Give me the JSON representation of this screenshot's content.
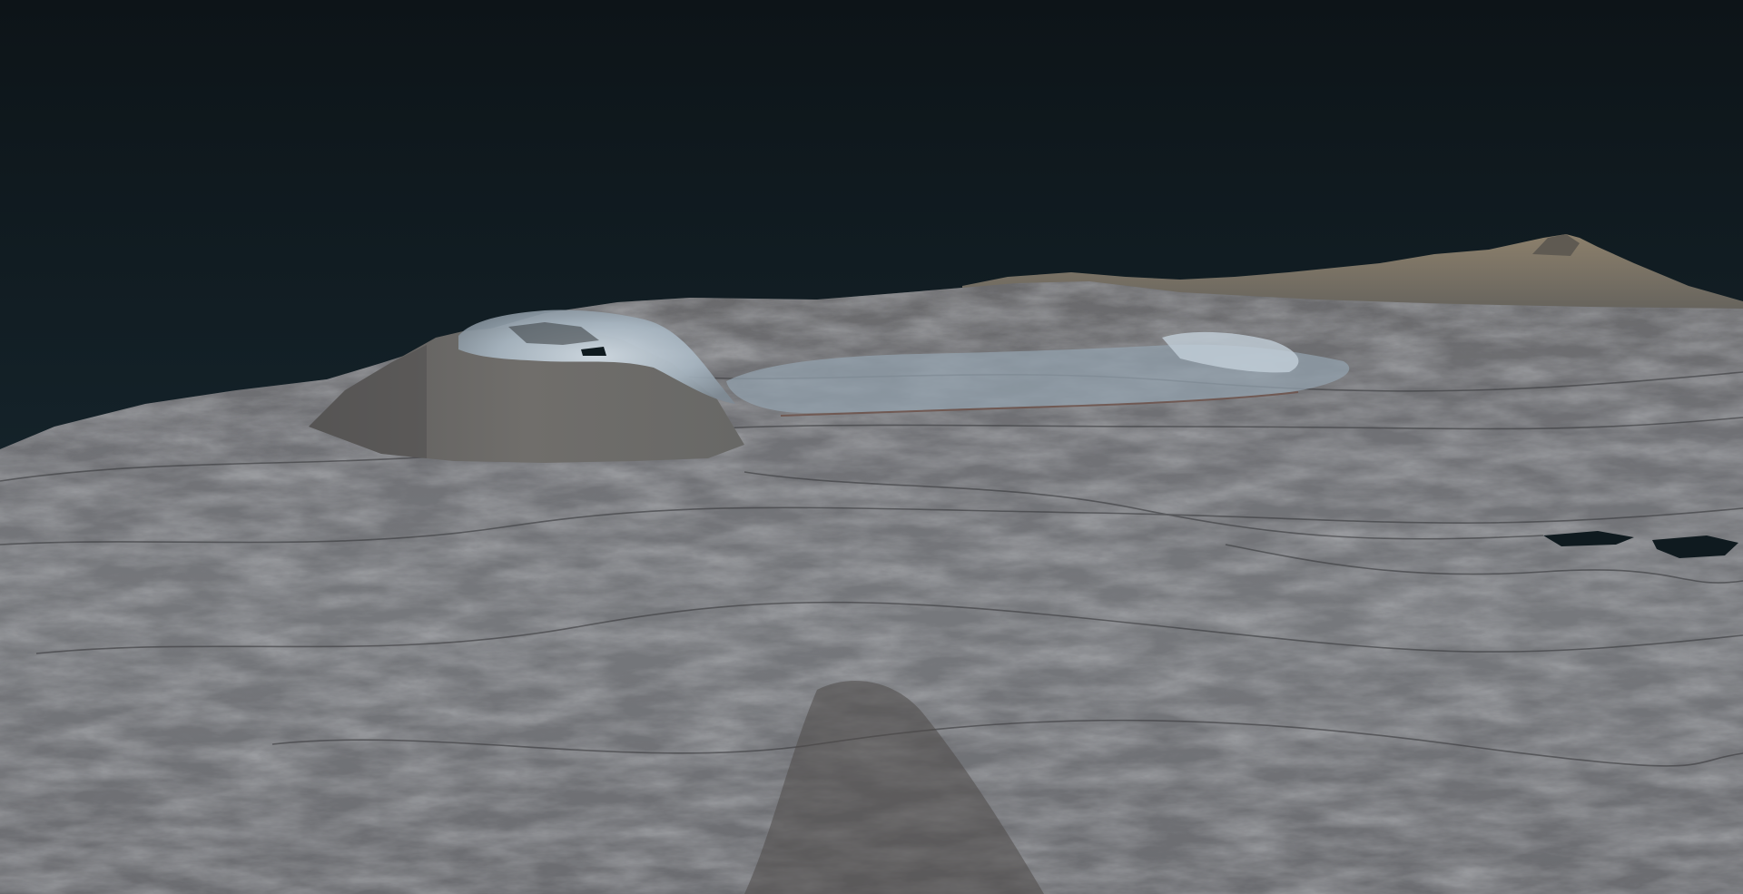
{
  "viewer": {
    "background_color": "#111c22",
    "terrain_base_color": "#6f6f72",
    "terrain_highlight_color": "#9ea7b0",
    "snow_color": "#c9d6e0",
    "ridge_color": "#8a7a66"
  }
}
